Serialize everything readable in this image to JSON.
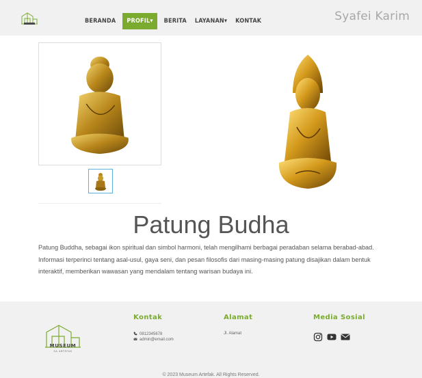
{
  "header": {
    "site_name": "Syafei Karim",
    "nav": [
      {
        "label": "BERANDA"
      },
      {
        "label": "PROFIL",
        "active": true
      },
      {
        "label": "BERITA"
      },
      {
        "label": "LAYANAN"
      },
      {
        "label": "KONTAK"
      }
    ],
    "accent_color": "#7aab2f"
  },
  "main": {
    "title": "Patung Budha",
    "description": "Patung Buddha, sebagai ikon spiritual dan simbol harmoni, telah mengilhami berbagai peradaban selama berabad-abad. Informasi terperinci tentang asal-usul, gaya seni, dan pesan filosofis dari masing-masing patung disajikan dalam bentuk interaktif, memberikan wawasan yang mendalam tentang warisan budaya ini."
  },
  "footer": {
    "logo_text": "MUSEUM",
    "logo_subtext": "SA ARTEFAK",
    "kontak_heading": "Kontak",
    "phone": "0812345678",
    "email": "admin@email.com",
    "alamat_heading": "Alamat",
    "address": "Jl. Alamat",
    "social_heading": "Media Sosial",
    "social_icons": [
      "instagram-icon",
      "youtube-icon",
      "envelope-icon"
    ],
    "copyright": "© 2023 Museum Artefak. All Rights Reserved."
  }
}
